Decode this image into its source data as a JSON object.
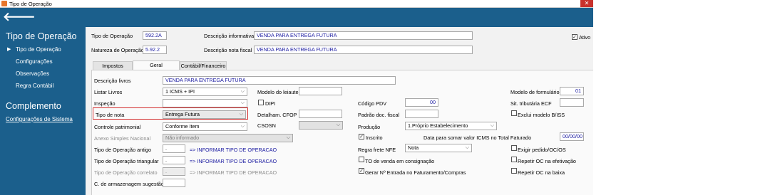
{
  "window": {
    "title": "Tipo de Operação",
    "close_glyph": "✕"
  },
  "header": {
    "back_glyph": "🡐"
  },
  "sidebar": {
    "heading": "Tipo de Operação",
    "items": [
      {
        "label": "Tipo de Operação",
        "selected": true
      },
      {
        "label": "Configurações"
      },
      {
        "label": "Observações"
      },
      {
        "label": "Regra Contábil"
      }
    ],
    "complement_heading": "Complemento",
    "complement_link": "Configurações de Sistema"
  },
  "top_form": {
    "tipo_operacao_label": "Tipo de Operação",
    "tipo_operacao_value": "592.2A",
    "natureza_label": "Natureza de Operação",
    "natureza_value": "5.92.2",
    "desc_info_label": "Descrição informativa",
    "desc_info_value": "VENDA PARA ENTREGA FUTURA",
    "desc_nota_label": "Descrição nota fiscal",
    "desc_nota_value": "VENDA PARA ENTREGA FUTURA",
    "ativo_label": "Ativo",
    "ativo_checked": true
  },
  "tabs": [
    "Impostos",
    "Geral",
    "Contábil/Financeiro"
  ],
  "active_tab": "Geral",
  "geral": {
    "descricao_livros_label": "Descrição livros",
    "descricao_livros_value": "VENDA PARA ENTREGA FUTURA",
    "listar_livros_label": "Listar Livros",
    "listar_livros_value": "1 ICMS + IPI",
    "inspecao_label": "Inspeção",
    "inspecao_value": "",
    "tipo_nota_label": "Tipo de nota",
    "tipo_nota_value": "Entrega Futura",
    "controle_patrimonial_label": "Controle patrimonial",
    "controle_patrimonial_value": "Conforme Item",
    "anexo_label": "Anexo Simples Nacional",
    "anexo_value": "Não informado",
    "tipo_op_antigo_label": "Tipo de Operação antigo",
    "tipo_op_antigo_value": ".",
    "tipo_op_antigo_link": "=> INFORMAR TIPO DE OPERACAO",
    "tipo_op_triangular_label": "Tipo de Operação triangular",
    "tipo_op_triangular_value": ".",
    "tipo_op_triangular_link": "=> INFORMAR TIPO DE OPERACAO",
    "tipo_op_correlato_label": "Tipo de Operação correlato",
    "tipo_op_correlato_value": ".",
    "tipo_op_correlato_link": "=> INFORMAR TIPO DE OPERACAO",
    "armazenagem_label": "C. de armazenagem sugestão",
    "armazenagem_value": "",
    "modelo_leiaute_label": "Modelo do leiaute",
    "modelo_leiaute_value": "",
    "dipi_label": "DIPI",
    "detalham_cfop_label": "Detalham. CFOP",
    "detalham_cfop_value": "",
    "csosn_label": "CSOSN",
    "csosn_value": "",
    "codigo_pdv_label": "Código PDV",
    "codigo_pdv_value": "00",
    "padrao_doc_fiscal_label": "Padrão doc. fiscal",
    "padrao_doc_fiscal_value": "",
    "producao_label": "Produção",
    "producao_value": "1.Próprio Estabelecimento",
    "inscrito_label": "Inscrito",
    "inscrito_checked": true,
    "data_somar_label": "Data para somar valor ICMS no Total Faturado",
    "data_somar_value": "00/00/00",
    "regra_frete_label": "Regra frete NFE",
    "regra_frete_value": "Nota",
    "to_venda_label": "TO de venda em consignação",
    "gerar_nf_label": "Gerar Nº Entrada no Faturamento/Compras",
    "gerar_nf_checked": true,
    "modelo_formulario_label": "Modelo de formulário",
    "modelo_formulario_value": "01",
    "sit_tributaria_label": "Sit. tributária ECF",
    "sit_tributaria_value": "",
    "exclui_modelo_label": "Exclui modelo B/ISS",
    "exigir_pedido_label": "Exigir pedido/OC/OS",
    "repetir_oc_efetivacao_label": "Repetir OC na efetivação",
    "repetir_oc_baixa_label": "Repetir OC na baixa"
  },
  "colors": {
    "sidebar_bg": "#1b5f8c",
    "highlight_border": "#d32a2a",
    "link_blue": "#1a1aa0"
  }
}
